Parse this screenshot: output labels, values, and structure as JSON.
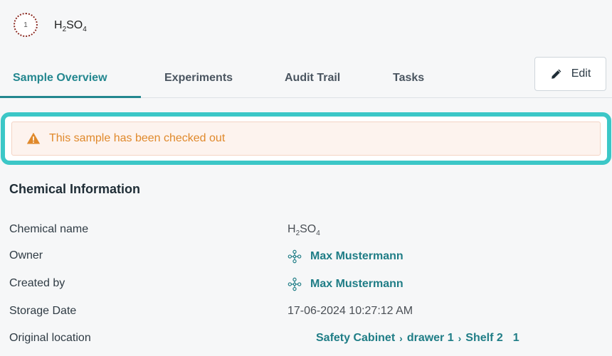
{
  "sample": {
    "badge_number": "1",
    "title_main": "H",
    "title_sub1": "2",
    "title_mid": "SO",
    "title_sub2": "4"
  },
  "tabs": [
    {
      "label": "Sample Overview",
      "active": true
    },
    {
      "label": "Experiments",
      "active": false
    },
    {
      "label": "Audit Trail",
      "active": false
    },
    {
      "label": "Tasks",
      "active": false
    }
  ],
  "toolbar": {
    "edit_label": "Edit"
  },
  "alert": {
    "message": "This sample has been checked out",
    "color": "#e0892b"
  },
  "section": {
    "title": "Chemical Information"
  },
  "fields": {
    "chemical_name": {
      "label": "Chemical name",
      "value_main": "H",
      "value_sub1": "2",
      "value_mid": "SO",
      "value_sub2": "4"
    },
    "owner": {
      "label": "Owner",
      "value": "Max Mustermann"
    },
    "created_by": {
      "label": "Created by",
      "value": "Max Mustermann"
    },
    "storage_date": {
      "label": "Storage Date",
      "value": "17-06-2024 10:27:12 AM"
    },
    "original_location": {
      "label": "Original location",
      "path": [
        "Safety Cabinet",
        "drawer 1",
        "Shelf 2"
      ],
      "trailing": "1"
    }
  },
  "colors": {
    "accent": "#23878f",
    "highlight": "#3cc7c7",
    "warning": "#e0892b"
  }
}
